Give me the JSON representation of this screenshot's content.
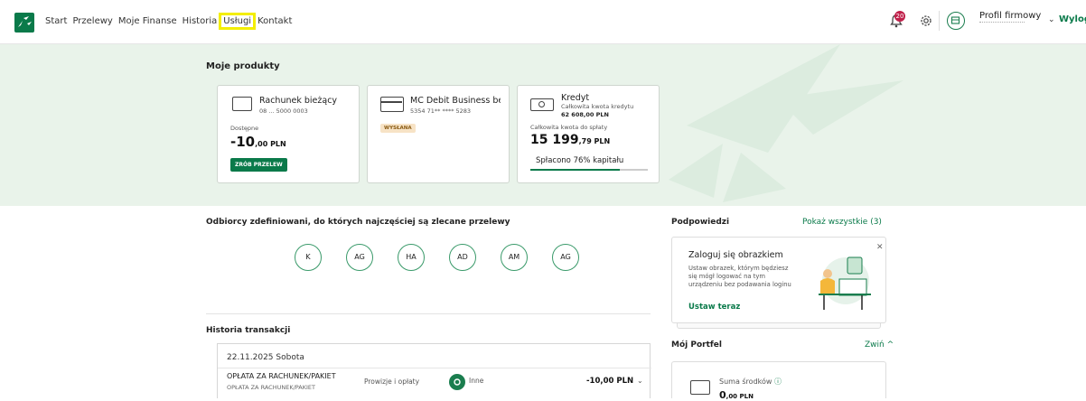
{
  "nav": {
    "items": [
      "Start",
      "Przelewy",
      "Moje Finanse",
      "Historia",
      "Usługi",
      "Kontakt"
    ],
    "highlighted": "Usługi"
  },
  "header": {
    "notifications_count": "20",
    "profile_label": "Profil firmowy",
    "logout_label": "Wyloguj"
  },
  "products": {
    "title": "Moje produkty",
    "account": {
      "name": "Rachunek bieżący",
      "number": "08 ... 5000 0003",
      "available_label": "Dostępne",
      "amount_main": "-10",
      "amount_fraction": ",00 PLN",
      "button": "ZRÓB PRZELEW"
    },
    "card": {
      "name": "MC Debit Business be...",
      "number": "5354 71** **** 5283",
      "status": "WYSŁANA"
    },
    "loan": {
      "name": "Kredyt",
      "total_label": "Całkowita kwota kredytu",
      "total_value": "62 608,00 PLN",
      "due_label": "Całkowita kwota do spłaty",
      "amount_main": "15 199",
      "amount_fraction": ",79 PLN",
      "progress_label": "Spłacono 76% kapitału",
      "progress": 0.76
    }
  },
  "recipients": {
    "title": "Odbiorcy zdefiniowani, do których najczęściej są zlecane przelewy",
    "items": [
      "K",
      "AG",
      "HA",
      "AD",
      "AM",
      "AG"
    ]
  },
  "history": {
    "title": "Historia transakcji",
    "date": "22.11.2025",
    "day": "Sobota",
    "row": {
      "title": "OPŁATA ZA RACHUNEK/PAKIET",
      "subtitle": "OPŁATA ZA RACHUNEK/PAKIET",
      "category": "Prowizje i opłaty",
      "type": "Inne",
      "amount": "-10,00 PLN"
    }
  },
  "hints": {
    "title": "Podpowiedzi",
    "show_all": "Pokaż wszystkie (3)",
    "card_title": "Zaloguj się obrazkiem",
    "card_body": "Ustaw obrazek, którym będziesz się mógł logować na tym urządzeniu bez podawania loginu",
    "card_link": "Ustaw teraz"
  },
  "portfel": {
    "title": "Mój Portfel",
    "collapse": "Zwiń",
    "sum_label": "Suma środków",
    "sum_main": "0",
    "sum_fraction": ",00 PLN"
  },
  "colors": {
    "brand_green": "#0a7a4a",
    "band_bg": "#e9f3ea",
    "highlight": "#f3ee00"
  }
}
